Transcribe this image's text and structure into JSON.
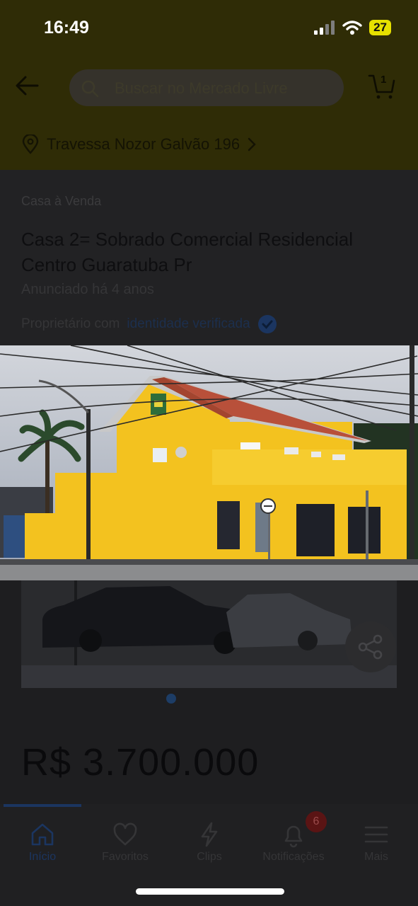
{
  "status_bar": {
    "time": "16:49",
    "battery": "27"
  },
  "header": {
    "search_placeholder": "Buscar no Mercado Livre",
    "cart_count": "1",
    "location": "Travessa Nozor Galvão 196"
  },
  "listing": {
    "category": "Casa à Venda",
    "title": "Casa 2= Sobrado Comercial Residencial Centro Guaratuba Pr",
    "posted": "Anunciado há 4 anos",
    "verified_prefix": "Proprietário com",
    "verified_highlight": "identidade verificada",
    "price": "R$ 3.700.000",
    "image_count": 1,
    "current_image": 1
  },
  "bottom_nav": {
    "tabs": [
      {
        "label": "Início",
        "icon": "home-icon",
        "active": true
      },
      {
        "label": "Favoritos",
        "icon": "heart-icon"
      },
      {
        "label": "Clips",
        "icon": "clips-icon"
      },
      {
        "label": "Notificações",
        "icon": "bell-icon",
        "badge": "6"
      },
      {
        "label": "Mais",
        "icon": "menu-icon"
      }
    ]
  },
  "colors": {
    "header_bg": "#2f2c06",
    "building_yellow": "#f3c21f",
    "roof": "#b8503a",
    "accent_blue": "#1b3560"
  }
}
